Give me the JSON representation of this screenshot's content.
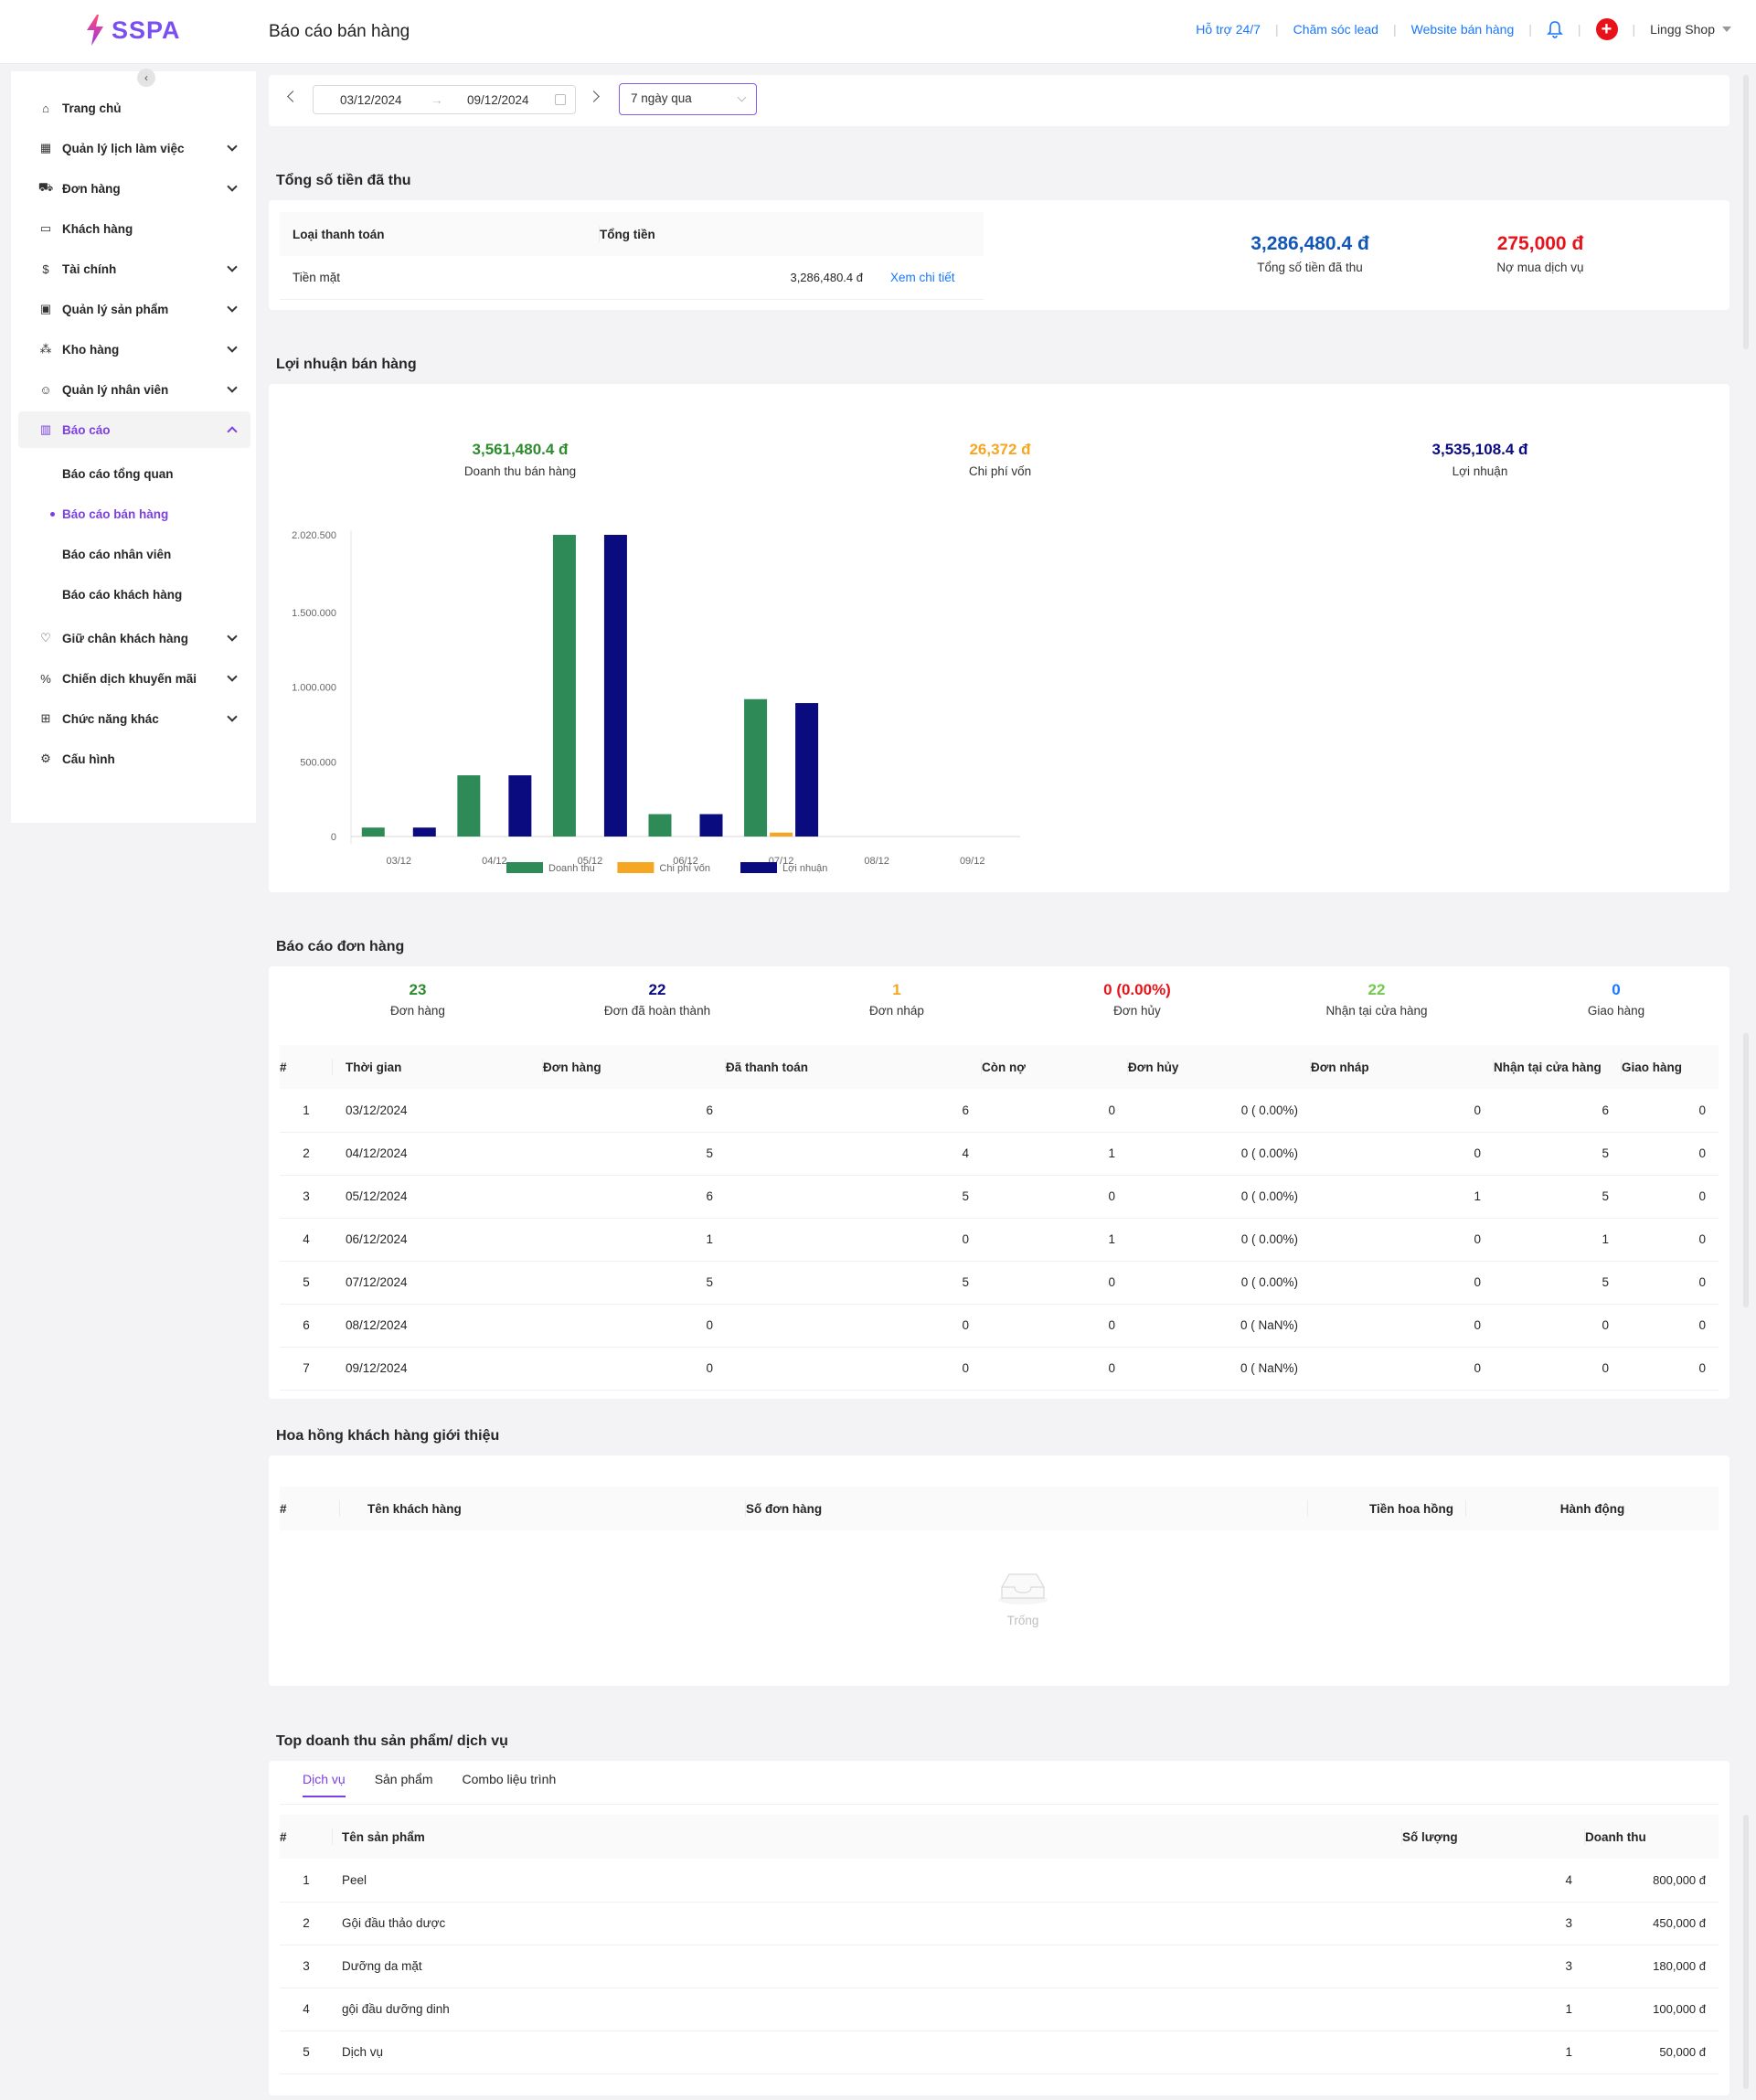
{
  "header": {
    "brand": "SSPA",
    "page_title": "Báo cáo bán hàng",
    "links": [
      "Hỗ trợ 24/7",
      "Chăm sóc lead",
      "Website bán hàng"
    ],
    "shop_name": "Lingg Shop"
  },
  "sidebar": {
    "items": [
      {
        "label": "Trang chủ",
        "icon": "home-icon"
      },
      {
        "label": "Quản lý lịch làm việc",
        "icon": "calendar-icon"
      },
      {
        "label": "Đơn hàng",
        "icon": "cart-icon"
      },
      {
        "label": "Khách hàng",
        "icon": "id-card-icon"
      },
      {
        "label": "Tài chính",
        "icon": "dollar-icon"
      },
      {
        "label": "Quản lý sản phẩm",
        "icon": "box-icon"
      },
      {
        "label": "Kho hàng",
        "icon": "warehouse-icon"
      },
      {
        "label": "Quản lý nhân viên",
        "icon": "users-icon"
      },
      {
        "label": "Báo cáo",
        "icon": "bar-chart-icon"
      },
      {
        "label": "Giữ chân khách hàng",
        "icon": "heart-icon"
      },
      {
        "label": "Chiến dịch khuyến mãi",
        "icon": "discount-icon"
      },
      {
        "label": "Chức năng khác",
        "icon": "apps-icon"
      },
      {
        "label": "Cấu hình",
        "icon": "settings-icon"
      }
    ],
    "report_sub": [
      "Báo cáo tổng quan",
      "Báo cáo bán hàng",
      "Báo cáo nhân viên",
      "Báo cáo khách hàng"
    ]
  },
  "filters": {
    "date_from": "03/12/2024",
    "date_to": "09/12/2024",
    "range": "7 ngày qua"
  },
  "payments": {
    "title": "Tổng số tiền đã thu",
    "col_type": "Loại thanh toán",
    "col_total": "Tổng tiền",
    "row_type": "Tiền mặt",
    "row_total": "3,286,480.4 đ",
    "row_link": "Xem chi tiết",
    "total_value": "3,286,480.4 đ",
    "total_label": "Tổng số tiền đã thu",
    "debt_value": "275,000 đ",
    "debt_label": "Nợ mua dịch vụ"
  },
  "profit": {
    "title": "Lợi nhuận bán hàng",
    "revenue_value": "3,561,480.4 đ",
    "revenue_label": "Doanh thu bán hàng",
    "cost_value": "26,372 đ",
    "cost_label": "Chi phí vốn",
    "profit_value": "3,535,108.4 đ",
    "profit_label": "Lợi nhuận"
  },
  "chart_data": {
    "type": "bar",
    "categories": [
      "03/12",
      "04/12",
      "05/12",
      "06/12",
      "07/12",
      "08/12",
      "09/12"
    ],
    "series": [
      {
        "name": "Doanh thu",
        "color": "#2e8b57",
        "values": [
          60000,
          410000,
          2020500,
          150000,
          920000,
          0,
          0
        ]
      },
      {
        "name": "Chi phí vốn",
        "color": "#f5a623",
        "values": [
          0,
          0,
          0,
          0,
          26372,
          0,
          0
        ]
      },
      {
        "name": "Lợi nhuận",
        "color": "#0b0b80",
        "values": [
          60000,
          410000,
          2020500,
          150000,
          893628,
          0,
          0
        ]
      }
    ],
    "yticks": [
      0,
      500000,
      1000000,
      1500000,
      2020500
    ],
    "ytick_labels": [
      "0",
      "500.000",
      "1.000.000",
      "1.500.000",
      "2.020.500"
    ],
    "ylim": [
      0,
      2020500
    ],
    "legend": "bottom"
  },
  "orders": {
    "title": "Báo cáo đơn hàng",
    "stats": [
      {
        "value": "23",
        "label": "Đơn hàng",
        "color": "#2e8b2e"
      },
      {
        "value": "22",
        "label": "Đơn đã hoàn thành",
        "color": "#0b0b80"
      },
      {
        "value": "1",
        "label": "Đơn nháp",
        "color": "#f5a623"
      },
      {
        "value": "0 (0.00%)",
        "label": "Đơn hủy",
        "color": "#e8121a"
      },
      {
        "value": "22",
        "label": "Nhận tại cửa hàng",
        "color": "#73c94b"
      },
      {
        "value": "0",
        "label": "Giao hàng",
        "color": "#1677ff"
      }
    ],
    "columns": [
      "#",
      "Thời gian",
      "Đơn hàng",
      "Đã thanh toán",
      "Còn nợ",
      "Đơn hủy",
      "Đơn nháp",
      "Nhận tại cửa hàng",
      "Giao hàng"
    ],
    "rows": [
      [
        "1",
        "03/12/2024",
        "6",
        "6",
        "0",
        "0 ( 0.00%)",
        "0",
        "6",
        "0"
      ],
      [
        "2",
        "04/12/2024",
        "5",
        "4",
        "1",
        "0 ( 0.00%)",
        "0",
        "5",
        "0"
      ],
      [
        "3",
        "05/12/2024",
        "6",
        "5",
        "0",
        "0 ( 0.00%)",
        "1",
        "5",
        "0"
      ],
      [
        "4",
        "06/12/2024",
        "1",
        "0",
        "1",
        "0 ( 0.00%)",
        "0",
        "1",
        "0"
      ],
      [
        "5",
        "07/12/2024",
        "5",
        "5",
        "0",
        "0 ( 0.00%)",
        "0",
        "5",
        "0"
      ],
      [
        "6",
        "08/12/2024",
        "0",
        "0",
        "0",
        "0 ( NaN%)",
        "0",
        "0",
        "0"
      ],
      [
        "7",
        "09/12/2024",
        "0",
        "0",
        "0",
        "0 ( NaN%)",
        "0",
        "0",
        "0"
      ]
    ]
  },
  "commission": {
    "title": "Hoa hồng khách hàng giới thiệu",
    "columns": [
      "#",
      "Tên khách hàng",
      "Số đơn hàng",
      "Tiền hoa hồng",
      "Hành động"
    ],
    "empty_text": "Trống"
  },
  "top": {
    "title": "Top doanh thu sản phẩm/ dịch vụ",
    "tabs": [
      "Dịch vụ",
      "Sản phẩm",
      "Combo liệu trình"
    ],
    "columns": [
      "#",
      "Tên sản phẩm",
      "Số lượng",
      "Doanh thu"
    ],
    "rows": [
      [
        "1",
        "Peel",
        "4",
        "800,000 đ"
      ],
      [
        "2",
        "Gội đầu thảo dược",
        "3",
        "450,000 đ"
      ],
      [
        "3",
        "Dưỡng da mặt",
        "3",
        "180,000 đ"
      ],
      [
        "4",
        "gội đầu dưỡng dinh",
        "1",
        "100,000 đ"
      ],
      [
        "5",
        "Dịch vụ",
        "1",
        "50,000 đ"
      ]
    ]
  }
}
